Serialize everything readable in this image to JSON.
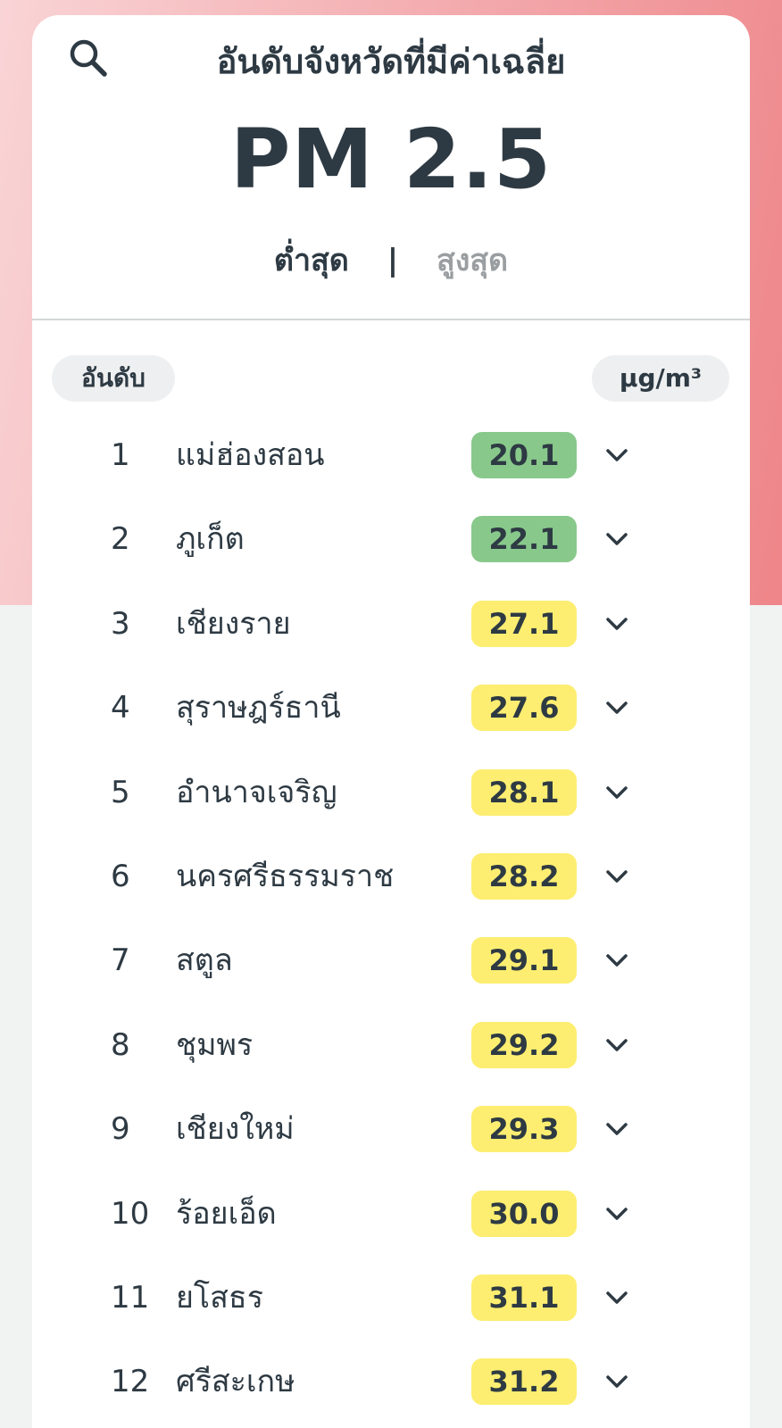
{
  "header": {
    "title_line1": "อันดับจังหวัดที่มีค่าเฉลี่ย",
    "title_line2": "PM 2.5",
    "search_icon": "search-icon"
  },
  "sort_tabs": {
    "lowest_label": "ต่ำสุด",
    "separator": "|",
    "highest_label": "สูงสุด",
    "selected": "ต่ำสุด"
  },
  "list_header": {
    "rank_label": "อันดับ",
    "unit_label": "µg/m³"
  },
  "colors": {
    "good": "#88c98b",
    "moderate": "#fdee71",
    "text": "#2e3a43",
    "background_accent": "#ee8589"
  },
  "rankings": [
    {
      "rank": "1",
      "province": "แม่ฮ่องสอน",
      "value": "20.1",
      "level": "good"
    },
    {
      "rank": "2",
      "province": "ภูเก็ต",
      "value": "22.1",
      "level": "good"
    },
    {
      "rank": "3",
      "province": "เชียงราย",
      "value": "27.1",
      "level": "moderate"
    },
    {
      "rank": "4",
      "province": "สุราษฎร์ธานี",
      "value": "27.6",
      "level": "moderate"
    },
    {
      "rank": "5",
      "province": "อำนาจเจริญ",
      "value": "28.1",
      "level": "moderate"
    },
    {
      "rank": "6",
      "province": "นครศรีธรรมราช",
      "value": "28.2",
      "level": "moderate"
    },
    {
      "rank": "7",
      "province": "สตูล",
      "value": "29.1",
      "level": "moderate"
    },
    {
      "rank": "8",
      "province": "ชุมพร",
      "value": "29.2",
      "level": "moderate"
    },
    {
      "rank": "9",
      "province": "เชียงใหม่",
      "value": "29.3",
      "level": "moderate"
    },
    {
      "rank": "10",
      "province": "ร้อยเอ็ด",
      "value": "30.0",
      "level": "moderate"
    },
    {
      "rank": "11",
      "province": "ยโสธร",
      "value": "31.1",
      "level": "moderate"
    },
    {
      "rank": "12",
      "province": "ศรีสะเกษ",
      "value": "31.2",
      "level": "moderate"
    }
  ]
}
